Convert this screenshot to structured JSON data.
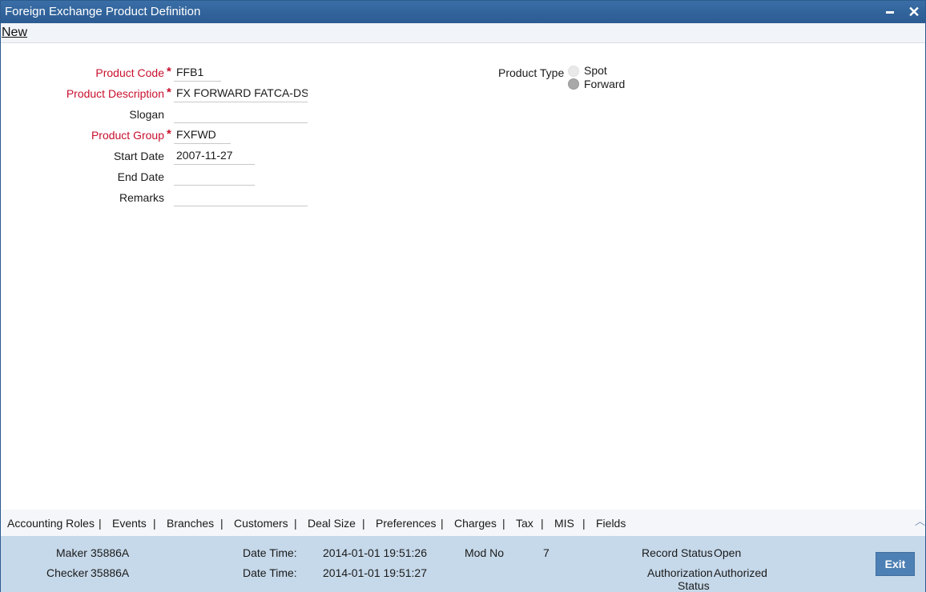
{
  "window": {
    "title": "Foreign Exchange Product Definition",
    "minimize_icon": "minimize-icon",
    "close_icon": "close-icon"
  },
  "menubar": {
    "new_label": "New"
  },
  "form": {
    "product_code": {
      "label": "Product Code",
      "required": true,
      "value": "FFB1"
    },
    "product_description": {
      "label": "Product Description",
      "required": true,
      "value": "FX FORWARD FATCA-DSLI"
    },
    "slogan": {
      "label": "Slogan",
      "required": false,
      "value": ""
    },
    "product_group": {
      "label": "Product Group",
      "required": true,
      "value": "FXFWD"
    },
    "start_date": {
      "label": "Start Date",
      "required": false,
      "value": "2007-11-27"
    },
    "end_date": {
      "label": "End Date",
      "required": false,
      "value": ""
    },
    "remarks": {
      "label": "Remarks",
      "required": false,
      "value": ""
    },
    "required_marker": "*",
    "product_type": {
      "label": "Product Type",
      "options": [
        {
          "label": "Spot",
          "selected": false
        },
        {
          "label": "Forward",
          "selected": true
        }
      ]
    }
  },
  "tabs": [
    "Accounting Roles",
    "Events",
    "Branches",
    "Customers",
    "Deal Size",
    "Preferences",
    "Charges",
    "Tax",
    "MIS",
    "Fields"
  ],
  "tab_separator": "|",
  "footer": {
    "maker_label": "Maker",
    "maker_value": "35886A",
    "checker_label": "Checker",
    "checker_value": "35886A",
    "date_time_label": "Date Time:",
    "maker_date_time": "2014-01-01 19:51:26",
    "checker_date_time": "2014-01-01 19:51:27",
    "mod_no_label": "Mod No",
    "mod_no_value": "7",
    "record_status_label": "Record Status",
    "record_status_value": "Open",
    "authorization_label_line1": "Authorization",
    "authorization_label_line2": "Status",
    "authorization_value": "Authorized",
    "exit_label": "Exit"
  },
  "colors": {
    "titlebar": "#2b5b92",
    "required_label": "#c8102e",
    "footer_bg": "#c6d9ea",
    "exit_button": "#4d80b4"
  }
}
